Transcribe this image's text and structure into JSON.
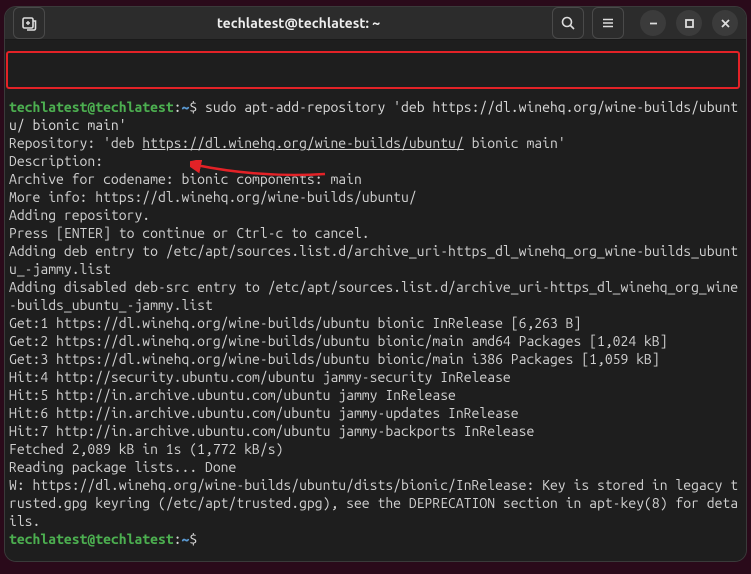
{
  "titlebar": {
    "title": "techlatest@techlatest: ~"
  },
  "prompt": {
    "user_host": "techlatest@techlatest",
    "colon": ":",
    "path": "~",
    "dollar": "$"
  },
  "command": {
    "text": " sudo apt-add-repository 'deb https://dl.winehq.org/wine-builds/ubuntu/ bionic main'"
  },
  "output": {
    "l1a": "Repository: 'deb ",
    "l1_link": "https://dl.winehq.org/wine-builds/ubuntu/",
    "l1b": " bionic main'",
    "l2": "Description:",
    "l3": "Archive for codename: bionic components: main",
    "l4": "More info: https://dl.winehq.org/wine-builds/ubuntu/",
    "l5": "Adding repository.",
    "l6": "Press [ENTER] to continue or Ctrl-c to cancel.",
    "l7": "Adding deb entry to /etc/apt/sources.list.d/archive_uri-https_dl_winehq_org_wine-builds_ubuntu_-jammy.list",
    "l8": "Adding disabled deb-src entry to /etc/apt/sources.list.d/archive_uri-https_dl_winehq_org_wine-builds_ubuntu_-jammy.list",
    "l9": "Get:1 https://dl.winehq.org/wine-builds/ubuntu bionic InRelease [6,263 B]",
    "l10": "Get:2 https://dl.winehq.org/wine-builds/ubuntu bionic/main amd64 Packages [1,024 kB]",
    "l11": "Get:3 https://dl.winehq.org/wine-builds/ubuntu bionic/main i386 Packages [1,059 kB]",
    "l12": "Hit:4 http://security.ubuntu.com/ubuntu jammy-security InRelease",
    "l13": "Hit:5 http://in.archive.ubuntu.com/ubuntu jammy InRelease",
    "l14": "Hit:6 http://in.archive.ubuntu.com/ubuntu jammy-updates InRelease",
    "l15": "Hit:7 http://in.archive.ubuntu.com/ubuntu jammy-backports InRelease",
    "l16": "Fetched 2,089 kB in 1s (1,772 kB/s)",
    "l17": "Reading package lists... Done",
    "l18": "W: https://dl.winehq.org/wine-builds/ubuntu/dists/bionic/InRelease: Key is stored in legacy trusted.gpg keyring (/etc/apt/trusted.gpg), see the DEPRECATION section in apt-key(8) for details."
  },
  "icons": {
    "new_tab": "new-tab-icon",
    "search": "search-icon",
    "menu": "menu-icon",
    "minimize": "minimize-icon",
    "maximize": "maximize-icon",
    "close": "close-icon"
  },
  "annotation": {
    "highlight_color": "#e32227"
  }
}
